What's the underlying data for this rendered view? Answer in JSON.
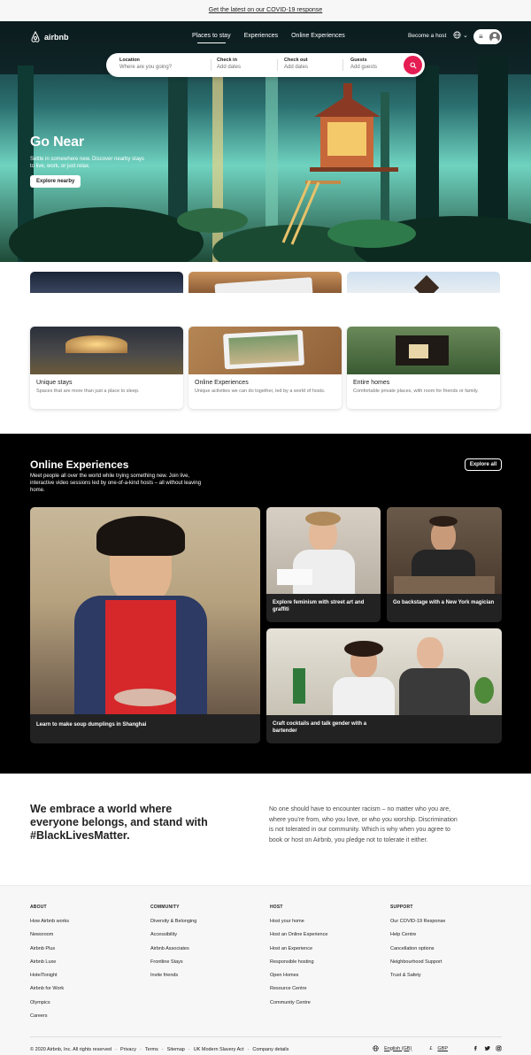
{
  "banner": {
    "text": "Get the latest on our COVID-19 response"
  },
  "brand": {
    "name": "airbnb",
    "accent": "#E51D53"
  },
  "nav": {
    "links": [
      "Places to stay",
      "Experiences",
      "Online Experiences"
    ],
    "active": "Places to stay",
    "become_host": "Become a host"
  },
  "search": {
    "location_label": "Location",
    "location_placeholder": "Where are you going?",
    "checkin_label": "Check in",
    "checkin_placeholder": "Add dates",
    "checkout_label": "Check out",
    "checkout_placeholder": "Add dates",
    "guests_label": "Guests",
    "guests_placeholder": "Add guests"
  },
  "hero": {
    "title": "Go Near",
    "subtitle": "Settle in somewhere new. Discover nearby stays to live, work, or just relax.",
    "button": "Explore nearby"
  },
  "cards": [
    {
      "title": "Unique stays",
      "desc": "Spaces that are more than just a place to sleep."
    },
    {
      "title": "Online Experiences",
      "desc": "Unique activities we can do together, led by a world of hosts."
    },
    {
      "title": "Entire homes",
      "desc": "Comfortable private places, with room for friends or family."
    }
  ],
  "online_experiences": {
    "title": "Online Experiences",
    "subtitle": "Meet people all over the world while trying something new. Join live, interactive video sessions led by one-of-a-kind hosts – all without leaving home.",
    "explore_all": "Explore all",
    "tiles": [
      {
        "caption": "Learn to make soup dumplings in Shanghai"
      },
      {
        "caption": "Explore feminism with street art and graffiti"
      },
      {
        "caption": "Go backstage with a New York magician"
      },
      {
        "caption": "Craft cocktails and talk gender with a bartender"
      }
    ]
  },
  "blm": {
    "heading": "We embrace a world where everyone belongs, and stand with #BlackLivesMatter.",
    "body": "No one should have to encounter racism – no matter who you are, where you’re from, who you love, or who you worship. Discrimination is not tolerated in our community. Which is why when you agree to book or host on Airbnb, you pledge not to tolerate it either."
  },
  "footer": {
    "columns": [
      {
        "heading": "ABOUT",
        "links": [
          "How Airbnb works",
          "Newsroom",
          "Airbnb Plus",
          "Airbnb Luxe",
          "HotelTonight",
          "Airbnb for Work",
          "Olympics",
          "Careers"
        ]
      },
      {
        "heading": "COMMUNITY",
        "links": [
          "Diversity & Belonging",
          "Accessibility",
          "Airbnb Associates",
          "Frontline Stays",
          "Invite friends"
        ]
      },
      {
        "heading": "HOST",
        "links": [
          "Host your home",
          "Host an Online Experience",
          "Host an Experience",
          "Responsible hosting",
          "Open Homes",
          "Resource Centre",
          "Community Centre"
        ]
      },
      {
        "heading": "SUPPORT",
        "links": [
          "Our COVID-19 Response",
          "Help Centre",
          "Cancellation options",
          "Neighbourhood Support",
          "Trust & Safety"
        ]
      }
    ],
    "copyright": "© 2020 Airbnb, Inc. All rights reserved",
    "legal_links": [
      "Privacy",
      "Terms",
      "Sitemap",
      "UK Modern Slavery Act",
      "Company details"
    ],
    "language": "English (GB)",
    "currency_symbol": "£",
    "currency": "GBP",
    "social_icons": [
      "facebook-icon",
      "twitter-icon",
      "instagram-icon"
    ]
  }
}
